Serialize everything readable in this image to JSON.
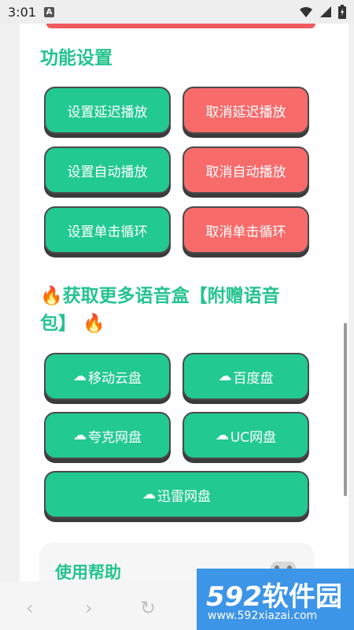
{
  "status_bar": {
    "time": "3:01",
    "notification_badge": "A"
  },
  "sections": {
    "function_settings_title": "功能设置",
    "more_voice_boxes_title": "获取更多语音盒【附赠语音包】",
    "help_title": "使用帮助"
  },
  "function_buttons": [
    {
      "label": "设置延迟播放",
      "color": "#22c990"
    },
    {
      "label": "取消延迟播放",
      "color": "#f86b6b"
    },
    {
      "label": "设置自动播放",
      "color": "#22c990"
    },
    {
      "label": "取消自动播放",
      "color": "#f86b6b"
    },
    {
      "label": "设置单击循环",
      "color": "#22c990"
    },
    {
      "label": "取消单击循环",
      "color": "#f86b6b"
    }
  ],
  "download_buttons": [
    {
      "label": "移动云盘"
    },
    {
      "label": "百度盘"
    },
    {
      "label": "夸克网盘"
    },
    {
      "label": "UC网盘"
    },
    {
      "label": "迅雷网盘"
    }
  ],
  "icons": {
    "fire": "🔥",
    "cloud": "☁",
    "back": "‹",
    "forward": "›",
    "reload": "↻"
  },
  "watermark": {
    "logo_number": "592",
    "logo_text": "软件园",
    "url": "www.592xiazai.com"
  },
  "colors": {
    "accent_green": "#24c48d",
    "button_green": "#22c990",
    "button_red": "#f86b6b"
  }
}
